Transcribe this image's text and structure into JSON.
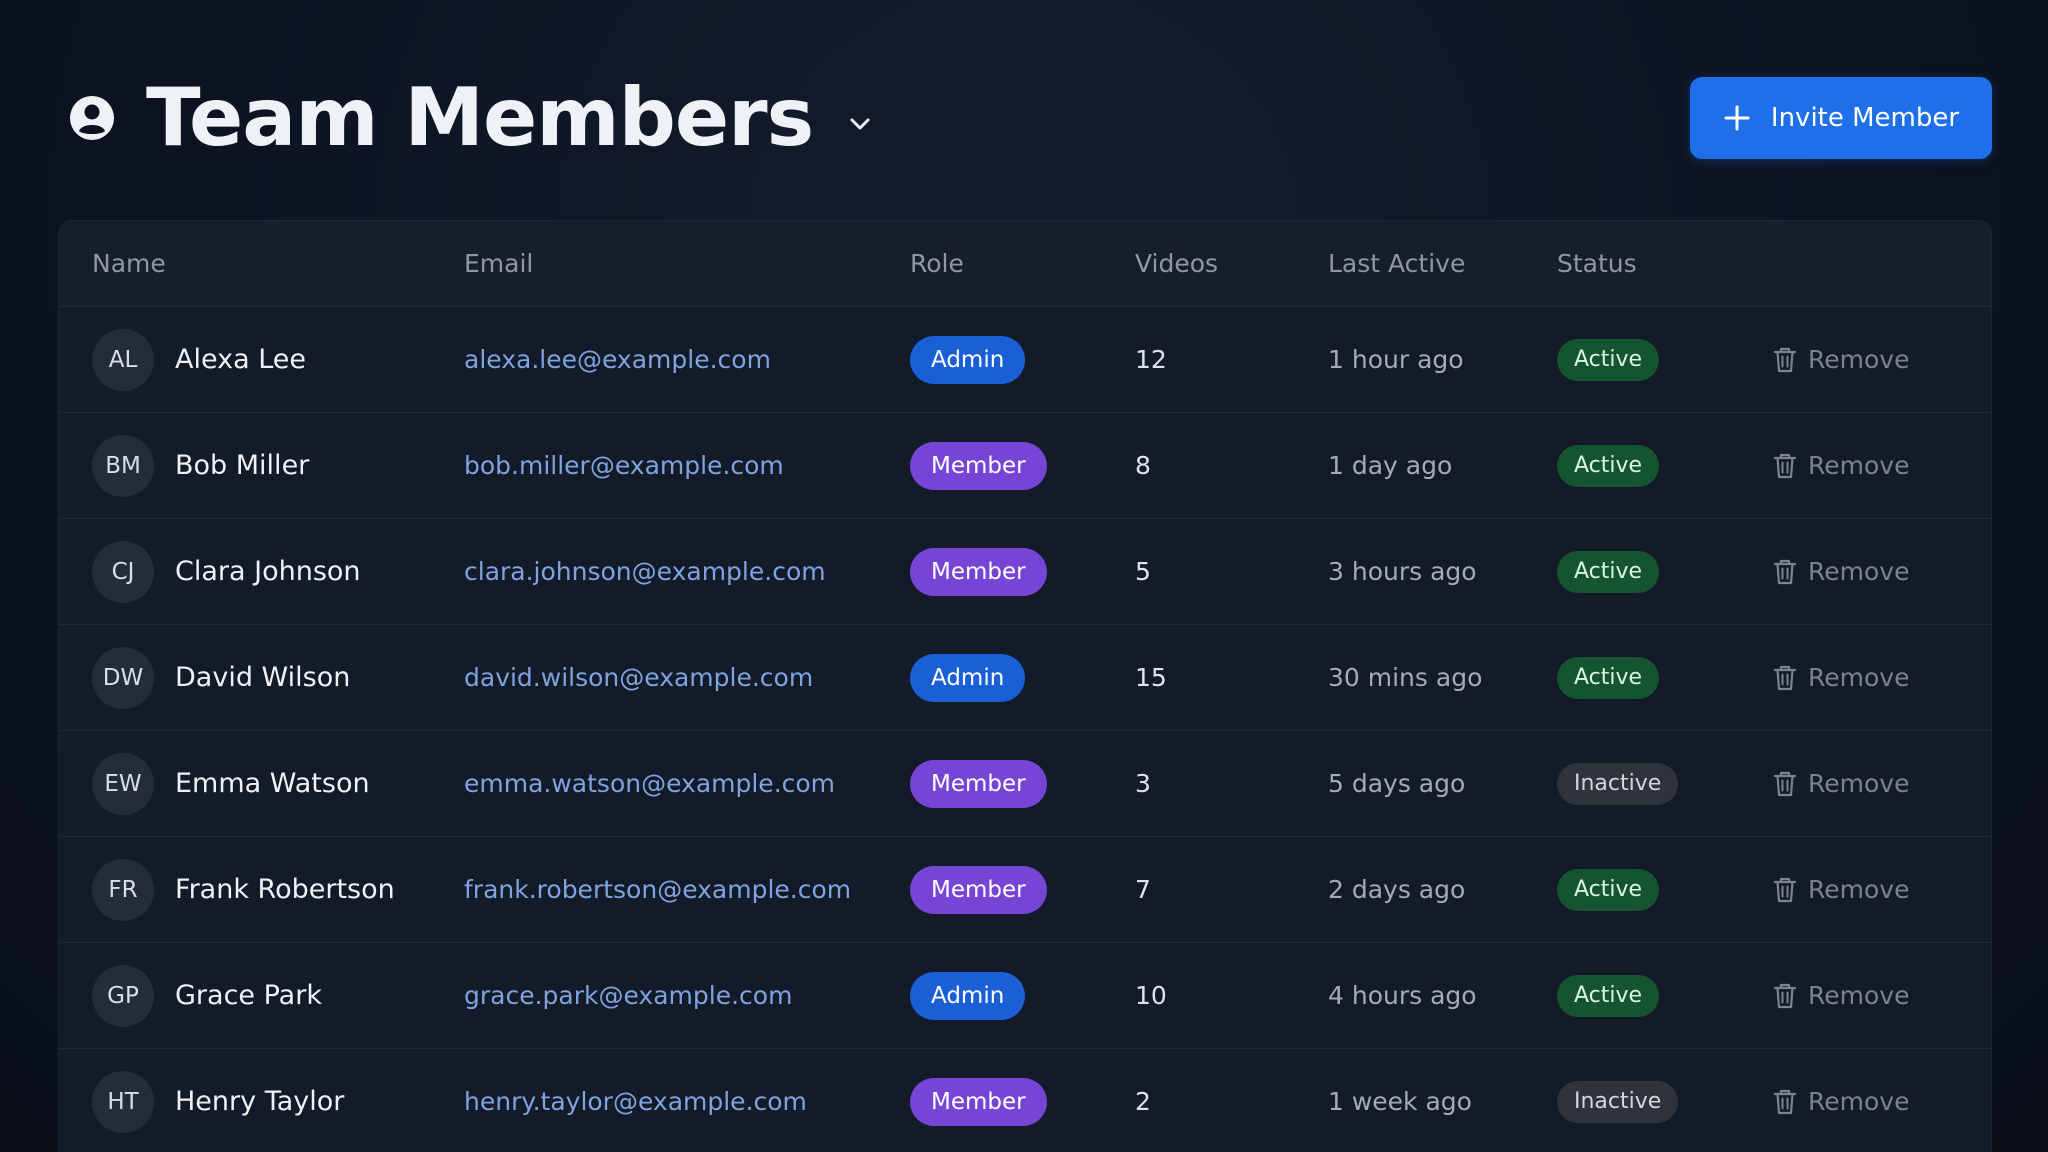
{
  "header": {
    "title": "Team Members",
    "invite_label": "Invite Member"
  },
  "table": {
    "columns": {
      "name": "Name",
      "email": "Email",
      "role": "Role",
      "videos": "Videos",
      "last_active": "Last Active",
      "status": "Status"
    },
    "remove_label": "Remove",
    "rows": [
      {
        "initials": "AL",
        "name": "Alexa Lee",
        "email": "alexa.lee@example.com",
        "role": "Admin",
        "videos": "12",
        "last_active": "1 hour ago",
        "status": "Active"
      },
      {
        "initials": "BM",
        "name": "Bob Miller",
        "email": "bob.miller@example.com",
        "role": "Member",
        "videos": "8",
        "last_active": "1 day ago",
        "status": "Active"
      },
      {
        "initials": "CJ",
        "name": "Clara Johnson",
        "email": "clara.johnson@example.com",
        "role": "Member",
        "videos": "5",
        "last_active": "3 hours ago",
        "status": "Active"
      },
      {
        "initials": "DW",
        "name": "David Wilson",
        "email": "david.wilson@example.com",
        "role": "Admin",
        "videos": "15",
        "last_active": "30 mins ago",
        "status": "Active"
      },
      {
        "initials": "EW",
        "name": "Emma Watson",
        "email": "emma.watson@example.com",
        "role": "Member",
        "videos": "3",
        "last_active": "5 days ago",
        "status": "Inactive"
      },
      {
        "initials": "FR",
        "name": "Frank Robertson",
        "email": "frank.robertson@example.com",
        "role": "Member",
        "videos": "7",
        "last_active": "2 days ago",
        "status": "Active"
      },
      {
        "initials": "GP",
        "name": "Grace Park",
        "email": "grace.park@example.com",
        "role": "Admin",
        "videos": "10",
        "last_active": "4 hours ago",
        "status": "Active"
      },
      {
        "initials": "HT",
        "name": "Henry Taylor",
        "email": "henry.taylor@example.com",
        "role": "Member",
        "videos": "2",
        "last_active": "1 week ago",
        "status": "Inactive"
      }
    ]
  },
  "colors": {
    "accent": "#1f6fe8",
    "admin_badge": "#1b5fd6",
    "member_badge": "#7645d6",
    "active_bg": "#14542f",
    "active_text": "#d9f5e3",
    "inactive_bg": "#2e333c",
    "inactive_text": "#d3d7de"
  },
  "icons": {
    "title": "user-circle-icon",
    "title_menu": "chevron-down-icon",
    "invite": "plus-icon",
    "remove": "trash-icon"
  }
}
